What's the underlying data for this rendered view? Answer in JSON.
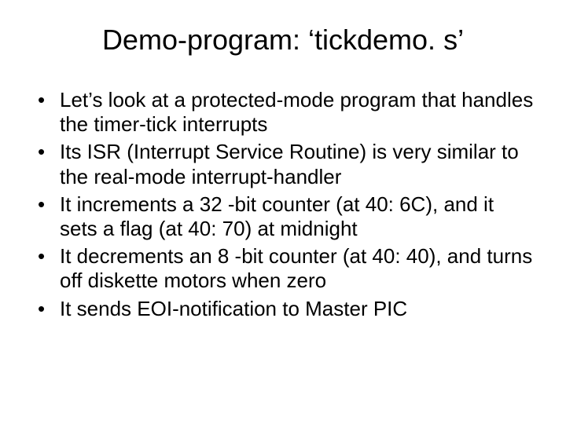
{
  "title": "Demo-program: ‘tickdemo. s’",
  "bullets": [
    "Let’s look at a protected-mode program that handles the timer-tick interrupts",
    "Its ISR (Interrupt Service Routine) is very similar to the real-mode interrupt-handler",
    "It increments a 32 -bit counter (at 40: 6C), and it sets a flag (at 40: 70) at midnight",
    "It decrements an 8 -bit counter (at 40: 40), and turns off diskette motors when zero",
    "It sends EOI-notification to Master PIC"
  ]
}
